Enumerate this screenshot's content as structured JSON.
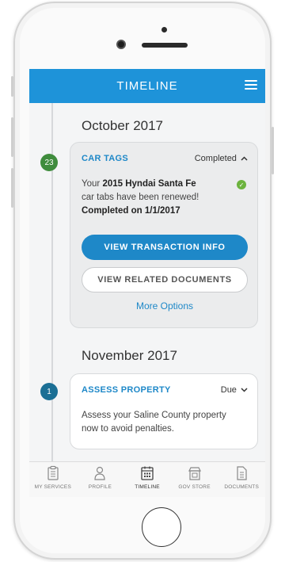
{
  "header": {
    "title": "TIMELINE"
  },
  "sections": [
    {
      "month": "October 2017",
      "badge": "23",
      "card": {
        "title": "CAR TAGS",
        "status": "Completed",
        "line1_prefix": "Your ",
        "line1_bold": "2015 Hyndai Santa Fe",
        "line2": "car tabs have been renewed!",
        "line3": "Completed on 1/1/2017",
        "primary_button": "VIEW TRANSACTION INFO",
        "secondary_button": "VIEW RELATED DOCUMENTS",
        "link": "More Options"
      }
    },
    {
      "month": "November 2017",
      "badge": "1",
      "card": {
        "title": "ASSESS PROPERTY",
        "status": "Due",
        "line1": "Assess your Saline County property",
        "line2": "now to avoid penalties."
      }
    }
  ],
  "tabs": [
    {
      "label": "MY SERVICES",
      "icon": "clipboard-icon"
    },
    {
      "label": "PROFILE",
      "icon": "person-icon"
    },
    {
      "label": "TIMELINE",
      "icon": "calendar-icon",
      "active": true
    },
    {
      "label": "GOV STORE",
      "icon": "storefront-icon"
    },
    {
      "label": "DOCUMENTS",
      "icon": "document-icon"
    }
  ],
  "colors": {
    "primary": "#1e93d9",
    "completed_badge": "#3f8c3d",
    "due_badge": "#1b6f95",
    "check": "#6cb33e"
  }
}
